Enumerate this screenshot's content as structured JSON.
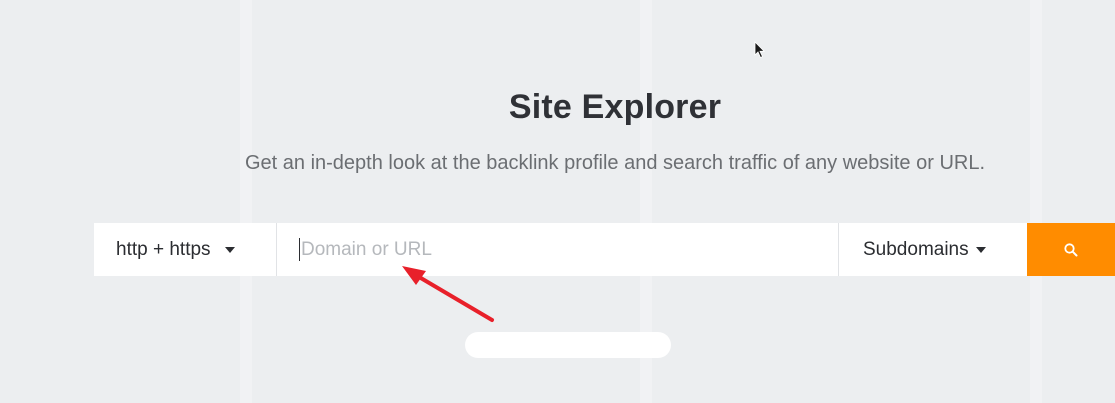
{
  "header": {
    "title": "Site Explorer",
    "subtitle": "Get an in-depth look at the backlink profile and search traffic of any website or URL."
  },
  "search": {
    "protocol_label": "http + https",
    "placeholder": "Domain or URL",
    "value": "",
    "mode_label": "Subdomains",
    "button_icon": "search-icon"
  },
  "colors": {
    "accent": "#ff8c00",
    "annotation_arrow": "#e8202a",
    "background": "#eceef0"
  }
}
